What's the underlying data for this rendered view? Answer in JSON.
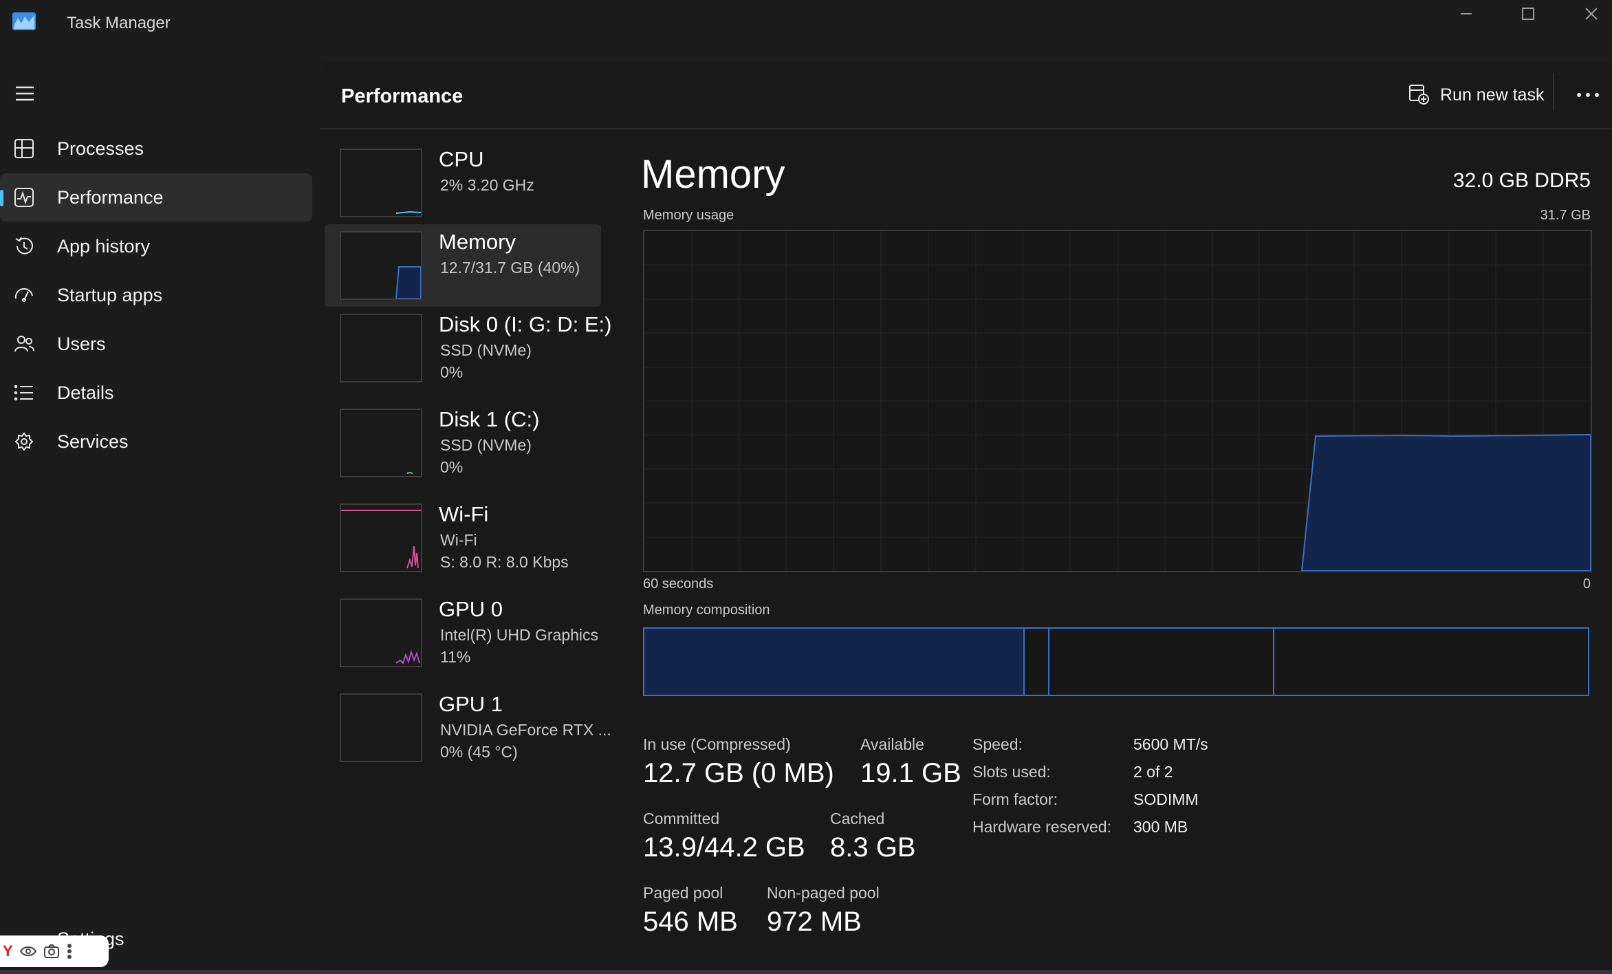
{
  "window": {
    "title": "Task Manager",
    "buttons": [
      "minimize-icon",
      "maximize-icon",
      "close-icon"
    ]
  },
  "sidebar": {
    "menu_icon": "hamburger-icon",
    "items": [
      {
        "label": "Processes",
        "icon": "processes-icon",
        "active": false
      },
      {
        "label": "Performance",
        "icon": "performance-icon",
        "active": true
      },
      {
        "label": "App history",
        "icon": "history-icon",
        "active": false
      },
      {
        "label": "Startup apps",
        "icon": "startup-icon",
        "active": false
      },
      {
        "label": "Users",
        "icon": "users-icon",
        "active": false
      },
      {
        "label": "Details",
        "icon": "details-icon",
        "active": false
      },
      {
        "label": "Services",
        "icon": "services-icon",
        "active": false
      }
    ],
    "settings_label": "Settings"
  },
  "header": {
    "title": "Performance",
    "run_new_task": "Run new task",
    "more_icon": "more-options-icon"
  },
  "resources": [
    {
      "name": "CPU",
      "line1": "2%  3.20 GHz",
      "line2": "",
      "active": false
    },
    {
      "name": "Memory",
      "line1": "12.7/31.7 GB (40%)",
      "line2": "",
      "active": true
    },
    {
      "name": "Disk 0 (I: G: D: E:)",
      "line1": "SSD (NVMe)",
      "line2": "0%",
      "active": false
    },
    {
      "name": "Disk 1 (C:)",
      "line1": "SSD (NVMe)",
      "line2": "0%",
      "active": false
    },
    {
      "name": "Wi-Fi",
      "line1": "Wi-Fi",
      "line2": "S: 8.0  R: 8.0 Kbps",
      "active": false
    },
    {
      "name": "GPU 0",
      "line1": "Intel(R) UHD Graphics",
      "line2": "11%",
      "active": false
    },
    {
      "name": "GPU 1",
      "line1": "NVIDIA GeForce RTX ...",
      "line2": "0%  (45 °C)",
      "active": false
    }
  ],
  "detail": {
    "title": "Memory",
    "spec": "32.0 GB DDR5",
    "usage_label": "Memory usage",
    "usage_max": "31.7 GB",
    "time_left": "60 seconds",
    "time_right": "0",
    "composition_label": "Memory composition",
    "stats": {
      "in_use_label": "In use (Compressed)",
      "in_use_value": "12.7 GB (0 MB)",
      "available_label": "Available",
      "available_value": "19.1 GB",
      "committed_label": "Committed",
      "committed_value": "13.9/44.2 GB",
      "cached_label": "Cached",
      "cached_value": "8.3 GB",
      "paged_label": "Paged pool",
      "paged_value": "546 MB",
      "nonpaged_label": "Non-paged pool",
      "nonpaged_value": "972 MB"
    },
    "specs": [
      {
        "label": "Speed:",
        "value": "5600 MT/s"
      },
      {
        "label": "Slots used:",
        "value": "2 of 2"
      },
      {
        "label": "Form factor:",
        "value": "SODIMM"
      },
      {
        "label": "Hardware reserved:",
        "value": "300 MB"
      }
    ]
  },
  "colors": {
    "accent": "#4cc2ff",
    "memory_line": "#3a6fc4",
    "memory_fill": "#13254a",
    "wifi_line": "#d4508c",
    "gpu_line": "#b04cc0"
  }
}
